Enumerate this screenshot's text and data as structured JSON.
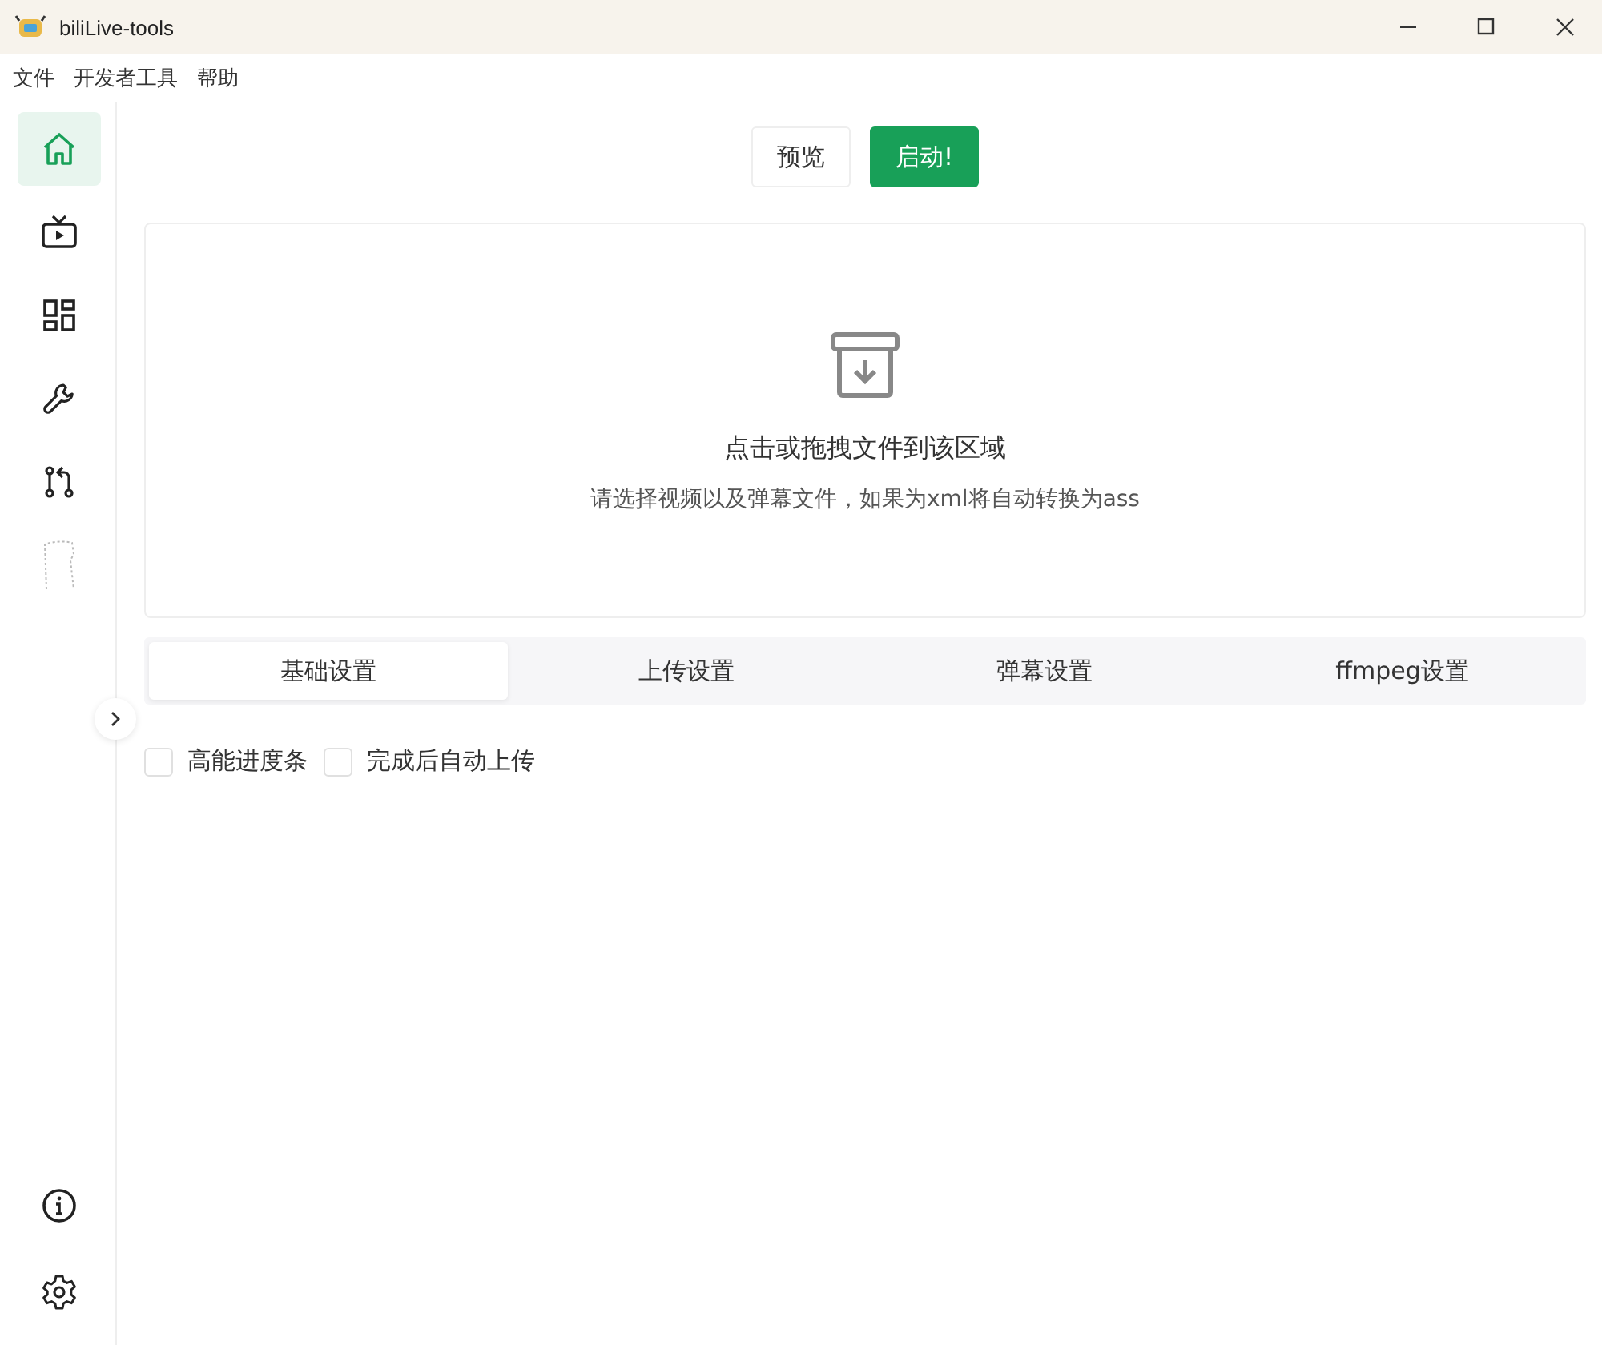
{
  "window": {
    "title": "biliLive-tools"
  },
  "menu": [
    "文件",
    "开发者工具",
    "帮助"
  ],
  "sidebar": {
    "items": [
      {
        "kind": "home",
        "selected": true
      },
      {
        "kind": "tv",
        "selected": false
      },
      {
        "kind": "grid",
        "selected": false
      },
      {
        "kind": "wrench",
        "selected": false
      },
      {
        "kind": "branch",
        "selected": false
      },
      {
        "kind": "outline",
        "selected": false
      }
    ],
    "bottom_items": [
      {
        "kind": "info",
        "selected": false
      },
      {
        "kind": "gear",
        "selected": false
      }
    ]
  },
  "actions": [
    {
      "label": "预览",
      "kind": "default"
    },
    {
      "label": "启动!",
      "kind": "primary"
    }
  ],
  "upload": {
    "title": "点击或拖拽文件到该区域",
    "hint": "请选择视频以及弹幕文件，如果为xml将自动转换为ass"
  },
  "tabs": [
    {
      "label": "基础设置",
      "selected": true
    },
    {
      "label": "上传设置",
      "selected": false
    },
    {
      "label": "弹幕设置",
      "selected": false
    },
    {
      "label": "ffmpeg设置",
      "selected": false
    }
  ],
  "options": [
    {
      "label": "高能进度条",
      "checked": false
    },
    {
      "label": "完成后自动上传",
      "checked": false
    }
  ]
}
